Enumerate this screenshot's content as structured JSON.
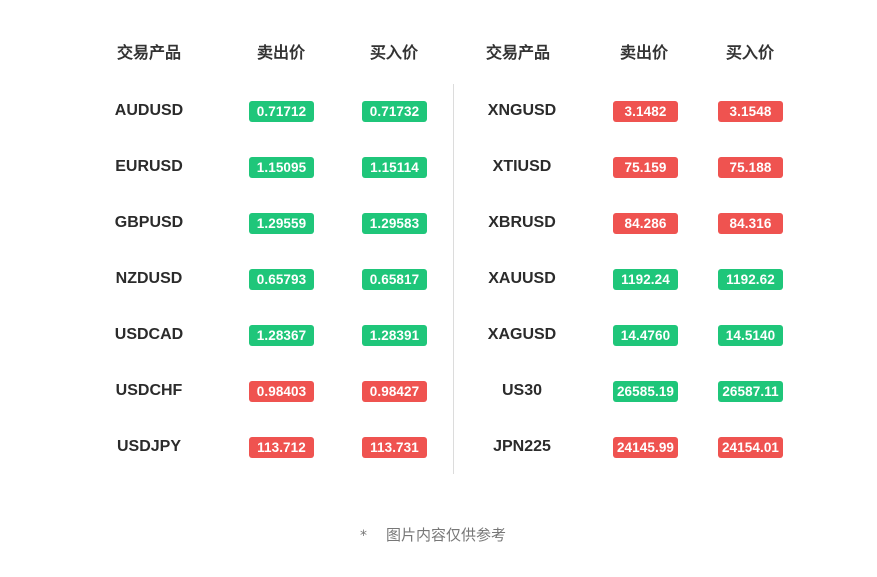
{
  "colors": {
    "up": "#1fc67a",
    "down": "#ef5350"
  },
  "headers": {
    "left": {
      "product": "交易产品",
      "sell": "卖出价",
      "buy": "买入价"
    },
    "right": {
      "product": "交易产品",
      "sell": "卖出价",
      "buy": "买入价"
    }
  },
  "left_rows": [
    {
      "symbol": "AUDUSD",
      "sell": "0.71712",
      "buy": "0.71732",
      "trend": "up"
    },
    {
      "symbol": "EURUSD",
      "sell": "1.15095",
      "buy": "1.15114",
      "trend": "up"
    },
    {
      "symbol": "GBPUSD",
      "sell": "1.29559",
      "buy": "1.29583",
      "trend": "up"
    },
    {
      "symbol": "NZDUSD",
      "sell": "0.65793",
      "buy": "0.65817",
      "trend": "up"
    },
    {
      "symbol": "USDCAD",
      "sell": "1.28367",
      "buy": "1.28391",
      "trend": "up"
    },
    {
      "symbol": "USDCHF",
      "sell": "0.98403",
      "buy": "0.98427",
      "trend": "down"
    },
    {
      "symbol": "USDJPY",
      "sell": "113.712",
      "buy": "113.731",
      "trend": "down"
    }
  ],
  "right_rows": [
    {
      "symbol": "XNGUSD",
      "sell": "3.1482",
      "buy": "3.1548",
      "trend": "down"
    },
    {
      "symbol": "XTIUSD",
      "sell": "75.159",
      "buy": "75.188",
      "trend": "down"
    },
    {
      "symbol": "XBRUSD",
      "sell": "84.286",
      "buy": "84.316",
      "trend": "down"
    },
    {
      "symbol": "XAUUSD",
      "sell": "1192.24",
      "buy": "1192.62",
      "trend": "up"
    },
    {
      "symbol": "XAGUSD",
      "sell": "14.4760",
      "buy": "14.5140",
      "trend": "up"
    },
    {
      "symbol": "US30",
      "sell": "26585.19",
      "buy": "26587.11",
      "trend": "up"
    },
    {
      "symbol": "JPN225",
      "sell": "24145.99",
      "buy": "24154.01",
      "trend": "down"
    }
  ],
  "footnote": {
    "marker": "*",
    "text": "图片内容仅供参考"
  }
}
